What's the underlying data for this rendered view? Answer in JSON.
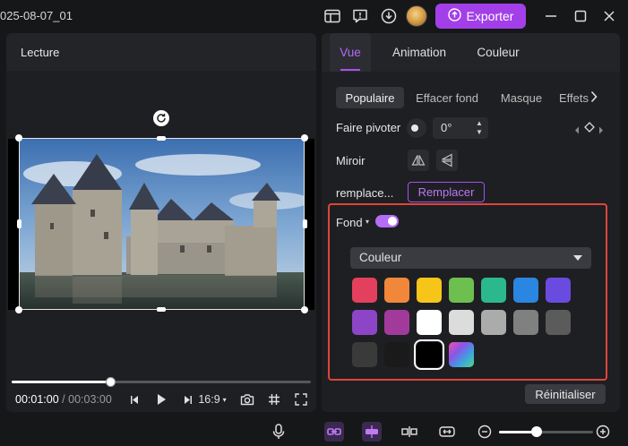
{
  "window": {
    "title": "025-08-07_01",
    "export_label": "Exporter"
  },
  "preview": {
    "header_label": "Lecture",
    "current_time": "00:01:00",
    "time_separator": "/",
    "total_time": "00:03:00",
    "playback_progress": 0.33,
    "aspect_ratio": "16:9"
  },
  "properties": {
    "tabs": [
      {
        "label": "Vue",
        "active": true
      },
      {
        "label": "Animation",
        "active": false
      },
      {
        "label": "Couleur",
        "active": false
      }
    ],
    "subtabs": [
      {
        "label": "Populaire",
        "active": true
      },
      {
        "label": "Effacer fond",
        "active": false
      },
      {
        "label": "Masque",
        "active": false
      },
      {
        "label": "Effets",
        "active": false
      }
    ],
    "rotate_label": "Faire pivoter",
    "rotate_value": "0°",
    "mirror_label": "Miroir",
    "replace_label": "remplace...",
    "replace_button": "Remplacer",
    "background_label": "Fond",
    "background_enabled": true,
    "background_type": "Couleur",
    "colors": [
      [
        "#e3405d",
        "#f0873a",
        "#f5c51a",
        "#6dbf4f",
        "#2cb88d",
        "#2a86e0",
        "#6a4be0"
      ],
      [
        "#8c45c6",
        "#a23a9c",
        "#ffffff",
        "#dcdcdc",
        "#ababab",
        "#808080",
        "#5b5b5b"
      ],
      [
        "#3a3a3a",
        "#1a1a1a",
        "#000000",
        "gradient"
      ]
    ],
    "selected_color": "#000000",
    "reset_label": "Réinitialiser"
  },
  "bottombar": {
    "zoom_level": 0.4
  },
  "colors": {
    "accent": "#a23fe8",
    "highlight": "#e0453b",
    "panel": "#1e1f22",
    "background": "#161719"
  }
}
